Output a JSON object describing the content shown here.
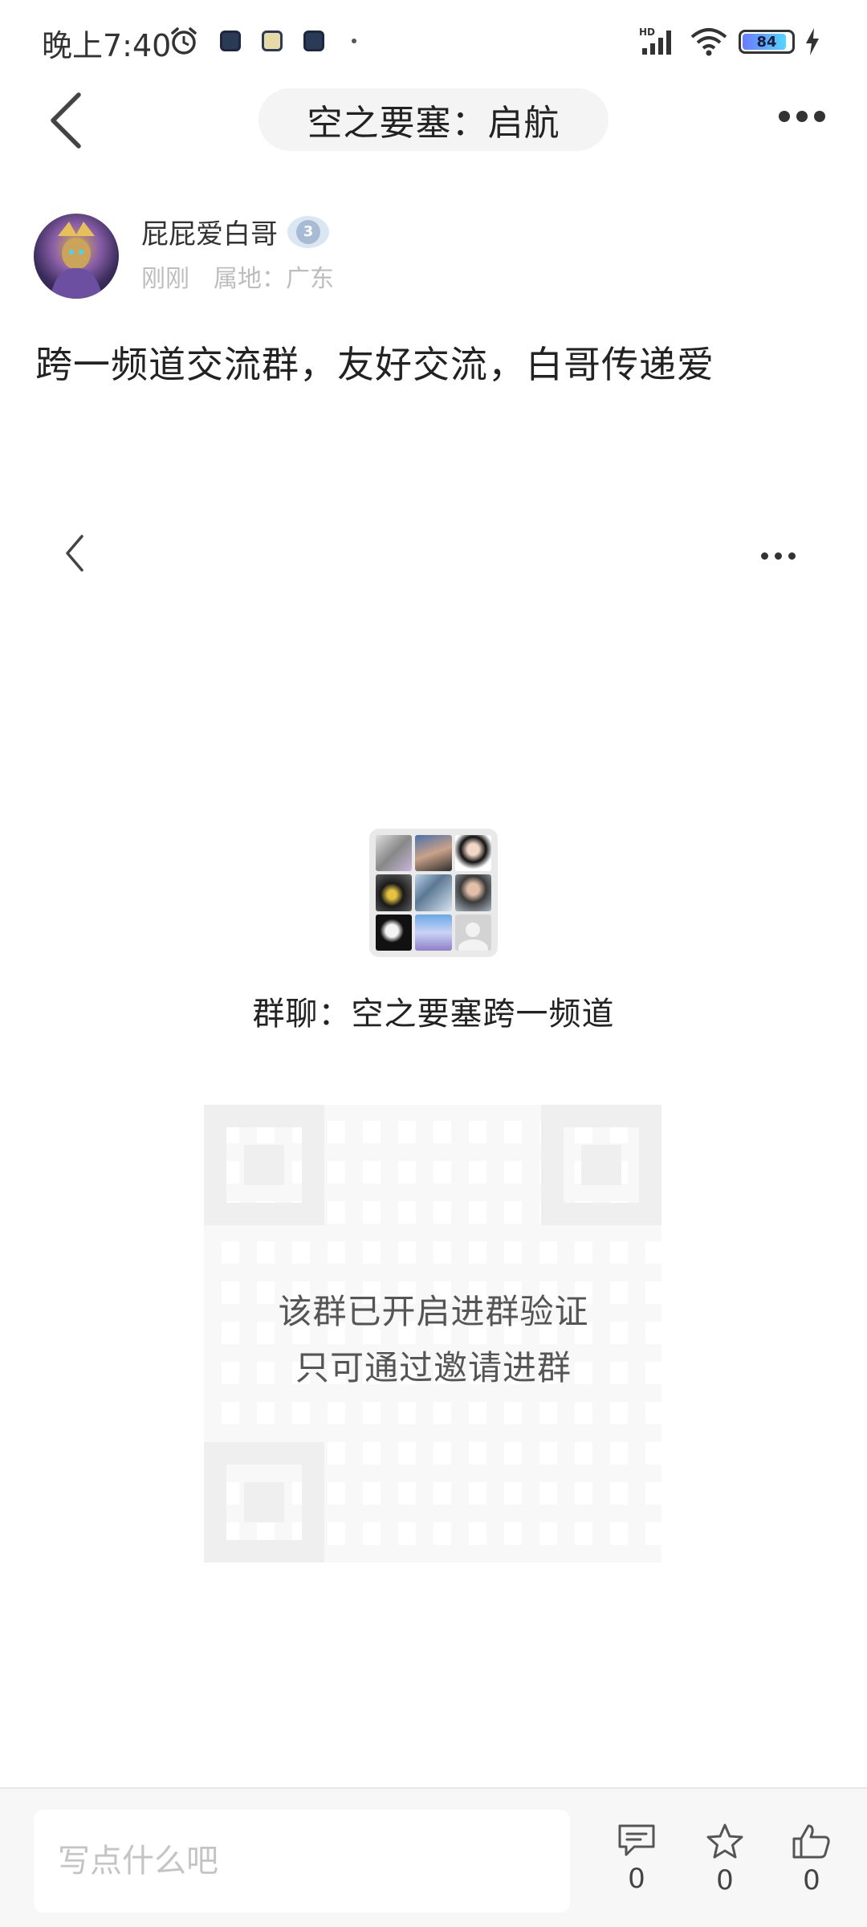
{
  "status_bar": {
    "time": "晚上7:40",
    "battery": "84",
    "network": "HD"
  },
  "nav": {
    "title": "空之要塞：启航"
  },
  "author": {
    "name": "屁屁爱白哥",
    "level": "3",
    "time": "刚刚",
    "location": "属地：广东"
  },
  "post": {
    "text": "跨一频道交流群，友好交流，白哥传递爱"
  },
  "group_card": {
    "name": "群聊：空之要塞跨一频道",
    "verify_line1": "该群已开启进群验证",
    "verify_line2": "只可通过邀请进群"
  },
  "bottom_bar": {
    "comment_placeholder": "写点什么吧",
    "comment_count": "0",
    "favorite_count": "0",
    "like_count": "0"
  },
  "icons": [
    "alarm-icon",
    "signal-icon",
    "wifi-icon",
    "battery-icon",
    "charging-icon",
    "back-icon",
    "more-icon",
    "comment-icon",
    "star-icon",
    "thumbs-up-icon"
  ]
}
